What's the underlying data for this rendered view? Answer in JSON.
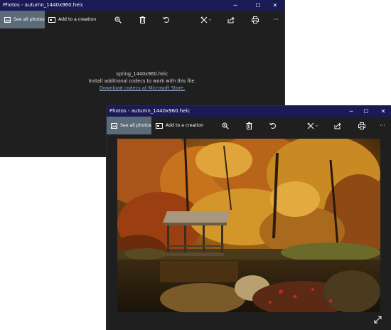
{
  "back_window": {
    "title": "Photos - autumn_1440x960.heic",
    "toolbar": {
      "see_all_photos": "See all photos",
      "add_to_creation": "Add to a creation"
    },
    "message": {
      "filename": "spring_1440x960.heic",
      "info": "Install additional codecs to work with this file.",
      "link": "Download codecs at Microsoft Store."
    },
    "controls": {
      "minimize": "─",
      "maximize": "☐",
      "close": "✕"
    },
    "more": "···"
  },
  "front_window": {
    "title": "Photos - autumn_1440x960.heic",
    "toolbar": {
      "see_all_photos": "See all photos",
      "add_to_creation": "Add to a creation"
    },
    "controls": {
      "minimize": "─",
      "maximize": "☐",
      "close": "✕"
    },
    "more": "···"
  },
  "icons": [
    "photos-icon",
    "add-creation-icon",
    "zoom-icon",
    "delete-icon",
    "rotate-icon",
    "edit-icon",
    "share-icon",
    "print-icon",
    "more-icon",
    "expand-icon"
  ],
  "colors": {
    "titlebar": "#1a1a56",
    "window_bg": "#1f1f1f",
    "active_tab": "#5c6b78",
    "link": "#8fa8c8"
  }
}
